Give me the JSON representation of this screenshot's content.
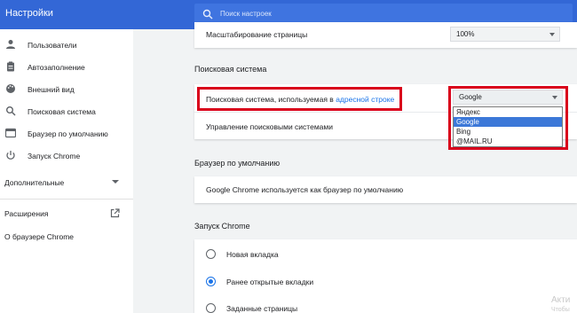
{
  "app": {
    "title": "Настройки"
  },
  "search": {
    "placeholder": "Поиск настроек"
  },
  "sidebar": {
    "items": [
      {
        "label": "Пользователи",
        "icon": "person-icon"
      },
      {
        "label": "Автозаполнение",
        "icon": "clipboard-icon"
      },
      {
        "label": "Внешний вид",
        "icon": "palette-icon"
      },
      {
        "label": "Поисковая система",
        "icon": "search-icon"
      },
      {
        "label": "Браузер по умолчанию",
        "icon": "browser-icon"
      },
      {
        "label": "Запуск Chrome",
        "icon": "power-icon"
      }
    ],
    "advanced_label": "Дополнительные",
    "extensions_label": "Расширения",
    "about_label": "О браузере Chrome"
  },
  "appearance": {
    "zoom_label": "Масштабирование страницы",
    "zoom_value": "100%"
  },
  "search_engine": {
    "section_title": "Поисковая система",
    "engine_label_prefix": "Поисковая система, используемая в ",
    "engine_label_link": "адресной строке",
    "selected": "Google",
    "options": [
      "Яндекс",
      "Google",
      "Bing",
      "@MAIL.RU"
    ],
    "manage_label": "Управление поисковыми системами"
  },
  "default_browser": {
    "section_title": "Браузер по умолчанию",
    "status": "Google Chrome используется как браузер по умолчанию"
  },
  "startup": {
    "section_title": "Запуск Chrome",
    "options": [
      {
        "label": "Новая вкладка",
        "checked": false
      },
      {
        "label": "Ранее открытые вкладки",
        "checked": true
      },
      {
        "label": "Заданные страницы",
        "checked": false
      }
    ]
  },
  "watermark": {
    "line1": "Акти",
    "line2": "Чтобы"
  },
  "colors": {
    "header": "#3367d6",
    "accent": "#1a73e8",
    "highlight": "#d9001b"
  }
}
